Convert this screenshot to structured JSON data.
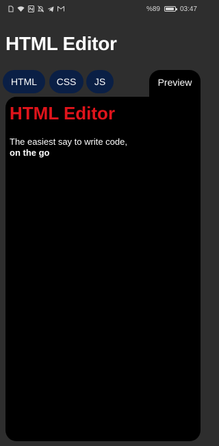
{
  "status_bar": {
    "battery": "%89",
    "time": "03:47",
    "icons": [
      "sim-icon",
      "wifi-icon",
      "nfc-icon",
      "silent-icon",
      "telegram-icon",
      "gmail-icon"
    ]
  },
  "app": {
    "title": "HTML Editor"
  },
  "tabs": [
    {
      "label": "HTML"
    },
    {
      "label": "CSS"
    },
    {
      "label": "JS"
    },
    {
      "label": "Preview"
    }
  ],
  "preview": {
    "heading": "HTML Editor",
    "text_line": "The easiest say to write code,",
    "text_bold": "on the go"
  },
  "colors": {
    "background": "#2e2e2e",
    "tab_pill": "#0a1f45",
    "preview_bg": "#000000",
    "heading_red": "#e0141b"
  }
}
